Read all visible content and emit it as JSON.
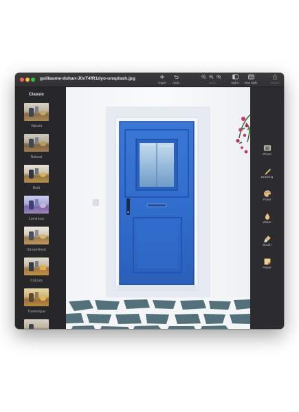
{
  "window": {
    "title": "guillaume-duhan-J0xT4fR1dyo-unsplash.jpg",
    "accent_colors": {
      "door_blue": "#2f6fd0",
      "flower_magenta": "#c2306e"
    }
  },
  "toolbar": {
    "import_label": "Import",
    "undo_label": "Undo",
    "zoom_label": "Zoom",
    "styles_label": "Styles",
    "new_style_label": "New Style",
    "export_label": "Export"
  },
  "sidebar": {
    "section_title": "Classic",
    "items": [
      {
        "label": "Vibrant",
        "icon": "preset-thumbnail"
      },
      {
        "label": "Natural",
        "icon": "preset-thumbnail"
      },
      {
        "label": "Bold",
        "icon": "preset-thumbnail"
      },
      {
        "label": "Luminous",
        "icon": "preset-thumbnail"
      },
      {
        "label": "Streamlined",
        "icon": "preset-thumbnail"
      },
      {
        "label": "Cutouts",
        "icon": "preset-thumbnail"
      },
      {
        "label": "Travelogue",
        "icon": "preset-thumbnail"
      },
      {
        "label": "",
        "icon": "preset-thumbnail"
      }
    ]
  },
  "rightbar": {
    "items": [
      {
        "label": "Photo",
        "icon": "photo-icon"
      },
      {
        "label": "Drawing",
        "icon": "pencil-icon"
      },
      {
        "label": "Paint",
        "icon": "palette-icon"
      },
      {
        "label": "Water",
        "icon": "water-drop-icon"
      },
      {
        "label": "Brush",
        "icon": "brush-icon"
      },
      {
        "label": "Paper",
        "icon": "paper-icon"
      }
    ]
  }
}
